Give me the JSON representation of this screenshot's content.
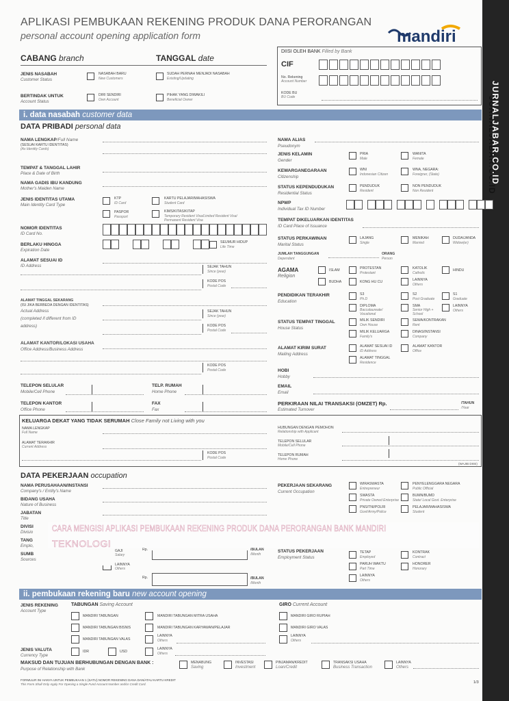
{
  "header": {
    "title": "APLIKASI PEMBUKAAN REKENING PRODUK DANA PERORANGAN",
    "subtitle": "personal account opening application form",
    "logo": "mandiri",
    "watermark": "JURNALJABAR.CO.ID"
  },
  "top": {
    "cabang": "CABANG",
    "cabang_en": "branch",
    "tanggal": "TANGGAL",
    "tanggal_en": "date",
    "jenis_nasabah": "JENIS NASABAH",
    "jenis_nasabah_en": "Customer Status",
    "nasabah_baru": "NASABAH BARU",
    "nasabah_baru_en": "New Customers",
    "sudah_pernah": "SUDAH PERNAH MENJADI NASABAH",
    "sudah_pernah_en": "Existing/Updating",
    "bertindak": "BERTINDAK UNTUK",
    "bertindak_en": "Account Status",
    "diri_sendiri": "DIRI SENDIRI",
    "diri_sendiri_en": "Own Account",
    "pihak_yang": "PIHAK YANG DIWAKILI",
    "pihak_yang_en": "Beneficial Owner",
    "diisi": "DIISI OLEH BANK",
    "diisi_en": "Filled by Bank",
    "cif": "CIF",
    "no_rek": "No. Rekening",
    "no_rek_en": "Account Number",
    "kode_bu": "KODE BU",
    "kode_bu_en": "BU Code"
  },
  "section1": {
    "num": "i. data nasabah",
    "en": "customer data"
  },
  "pribadi": {
    "title": "DATA PRIBADI",
    "title_en": "personal data",
    "nama_lengkap": "NAMA LENGKAP",
    "nama_lengkap_en": "/Full Name",
    "nama_note": "(SESUAI KARTU IDENTITAS)",
    "nama_note_en": "(As Identity Cards)",
    "ttl": "TEMPAT & TANGGAL LAHIR",
    "ttl_en": "Place & Date of Birth",
    "ibu": "NAMA GADIS IBU KANDUNG",
    "ibu_en": "Mother's Maiden Name",
    "identitas": "JENIS IDENTITAS UTAMA",
    "identitas_en": "Main Identity Card Type",
    "ktp": "KTP",
    "ktp_en": "ID Card",
    "paspor": "PASPOR",
    "paspor_en": "Passport",
    "kartu_pelajar": "KARTU PELAJAR/MAHASISWA",
    "kartu_pelajar_en": "Student Card",
    "kims": "KIMS/KITAS/KITAP",
    "kims_en1": "Temporary Resident Visa/Limited Resident Visa/",
    "kims_en2": "Permanent Resident Visa",
    "nomor": "NOMOR IDENTITAS",
    "nomor_en": "ID Card No.",
    "berlaku": "BERLAKU HINGGA",
    "berlaku_en": "Expiration Date",
    "seumur": "SEUMUR HIDUP",
    "seumur_en": "Life Time",
    "alamat_id": "ALAMAT SESUAI ID",
    "alamat_id_en": "ID Address",
    "sejak": "SEJAK TAHUN",
    "sejak_en": "Since (year)",
    "kodepos": "KODE POS",
    "kodepos_en": "Postal Code",
    "alamat_tinggal": "ALAMAT TINGGAL SEKARANG",
    "alamat_tinggal_note": "(ISI JIKA BERBEDA DENGAN IDENTITAS)",
    "alamat_tinggal_en": "Actual Address",
    "alamat_tinggal_en2": "(completed if different from ID",
    "alamat_tinggal_en3": "address)",
    "alamat_kantor": "ALAMAT KANTOR/LOKASI USAHA",
    "alamat_kantor_en": "Office Address/Business Address",
    "telp_seluler": "TELEPON SELULAR",
    "telp_seluler_en": "Mobile/Cell Phone",
    "telp_rumah": "TELP. RUMAH",
    "telp_rumah_en": "Home Phone",
    "telp_kantor": "TELEPON KANTOR",
    "telp_kantor_en": "Office Phone",
    "fax": "FAX",
    "fax_en": "Fax"
  },
  "right": {
    "alias": "NAMA ALIAS",
    "alias_en": "Pseudonym",
    "kelamin": "JENIS KELAMIN",
    "kelamin_en": "Gender",
    "pria": "PRIA",
    "pria_en": "Male",
    "wanita": "WANITA",
    "wanita_en": "Female",
    "kewarga": "KEWARGANEGARAAN",
    "kewarga_en": "Citizenship",
    "wni": "WNI",
    "wni_en": "Indonesian Citizen",
    "wna": "WNA, NEGARA:",
    "wna_en": "Foreigner, (State)",
    "status_kep": "STATUS KEPENDUDUKAN",
    "status_kep_en": "Residential Status",
    "penduduk": "PENDUDUK",
    "penduduk_en": "Resident",
    "non_penduduk": "NON PENDUDUK",
    "non_penduduk_en": "Non Resident",
    "npwp": "NPWP",
    "npwp_en": "Individual Tax ID Number",
    "tempat_keluar": "TEMPAT DIKELUARKAN IDENTITAS",
    "tempat_keluar_en": "ID Card Place of Issuance",
    "perkawinan": "STATUS PERKAWINAN",
    "perkawinan_en": "Marital Status",
    "lajang": "LAJANG",
    "lajang_en": "Single",
    "menikah": "MENIKAH",
    "menikah_en": "Married",
    "duda": "DUDA/JANDA",
    "duda_en": "Widow(er)",
    "tanggungan": "JUMLAH TANGGUNGAN",
    "tanggungan_en": "Dependant",
    "orang": "ORANG",
    "orang_en": "Person",
    "agama": "AGAMA",
    "agama_en": "Religion",
    "islam": "ISLAM",
    "protestan": "PROTESTAN",
    "protestan_en": "Protestant",
    "katolik": "KATOLIK",
    "katolik_en": "Catholic",
    "hindu": "HINDU",
    "budha": "BUDHA",
    "konghucu": "KONG HU CU",
    "lainnya": "LAINNYA",
    "lainnya_en": "Others",
    "pendidikan": "PENDIDIKAN TERAKHIR",
    "pendidikan_en": "Education",
    "s3": "S3",
    "s3_en": "Ph.D",
    "s2": "S2",
    "s2_en": "Post Graduate",
    "s1": "S1",
    "s1_en": "Graduate",
    "diploma": "DIPLOMA",
    "diploma_en": "Baccalaureate/",
    "diploma_en2": "Vocational",
    "sma": "SMA",
    "sma_en": "Senior High +",
    "sma_en2": "School",
    "status_tinggal": "STATUS TEMPAT TINGGAL",
    "status_tinggal_en": "House Status",
    "milik_sendiri": "MILIK SENDIRI",
    "milik_sendiri_en": "Own House",
    "sewa": "SEWA/KONTRAKAN",
    "sewa_en": "Rent",
    "milik_keluarga": "MILIK KELUARGA",
    "milik_keluarga_en": "Family's",
    "dinas": "DINAS/INSTANSI",
    "dinas_en": "Company",
    "kirim": "ALAMAT KIRIM SURAT",
    "kirim_en": "Mailing Address",
    "kirim_id": "ALAMAT SESUAI ID",
    "kirim_id_en": "ID Address",
    "kirim_kantor": "ALAMAT KANTOR",
    "kirim_kantor_en": "Office",
    "kirim_tinggal": "ALAMAT TINGGAL",
    "kirim_tinggal_en": "Residence",
    "hobi": "HOBI",
    "hobi_en": "Hobby",
    "email": "EMAIL",
    "email_en": "Email",
    "omzet": "PERKIRAAN NILAI TRANSAKSI (OMZET) Rp.",
    "omzet_en": "Estimated Turnover",
    "tahun": "/TAHUN",
    "tahun_en": "/Year"
  },
  "keluarga": {
    "title": "KELUARGA DEKAT YANG TIDAK SERUMAH",
    "title_en": "Close Family not Living with you",
    "nama": "NAMA LENGKAP",
    "nama_en": "Full Name",
    "alamat": "ALAMAT TERAKHIR",
    "alamat_en": "Current Address",
    "kodepos": "KODE POS",
    "kodepos_en": "Postal Code",
    "hubungan": "HUBUNGAN DENGAN PEMOHON",
    "hubungan_en": "Relationship with Applicant",
    "seluler": "TELEPON SELULAR",
    "seluler_en": "Mobile/Cell Phone",
    "rumah": "TELEPON RUMAH",
    "rumah_en": "Home Phone",
    "wajib": "(WAJIB DIISI)"
  },
  "pekerjaan": {
    "title": "DATA PEKERJAAN",
    "title_en": "occupation",
    "perusahaan": "NAMA PERUSAHAAN/INSTANSI",
    "perusahaan_en": "Company's / Entity's Name",
    "bidang": "BIDANG USAHA",
    "bidang_en": "Nature of Business",
    "jabatan": "JABATAN",
    "jabatan_en": "Title",
    "divisi": "DIVISI",
    "divisi_en": "Divisio",
    "tang": "TANG",
    "tang_en": "Emplo,",
    "sumb": "SUMB",
    "sumb_en": "Sources",
    "gaji": "GAJI",
    "gaji_en": "Salary",
    "lainnya": "LAINNYA",
    "lainnya_en": "Others",
    "rp": "Rp.",
    "bulan": "/BULAN",
    "bulan_en": "/Month",
    "sekarang": "PEKERJAAN SEKARANG",
    "sekarang_en": "Current Occupation",
    "wiraswasta": "WIRASWASTA",
    "wiraswasta_en": "Entrepreneur",
    "penyelenggara": "PENYELENGGARA NEGARA",
    "penyelenggara_en": "Public Official",
    "swasta": "SWASTA",
    "swasta_en": "Private Owned Enterprise",
    "bumn": "BUMN/BUMD",
    "bumn_en": "State/ Local Govt. Enterprise",
    "pns": "PNS/TNI/POLRI",
    "pns_en": "Govt/Army/Police",
    "pelajar": "PELAJAR/MAHASISWA",
    "pelajar_en": "Student",
    "status": "STATUS PEKERJAAN",
    "status_en": "Employment Status",
    "tetap": "TETAP",
    "tetap_en": "Employed",
    "kontrak": "KONTRAK",
    "kontrak_en": "Contract",
    "paruh": "PARUH WAKTU",
    "paruh_en": "Part Time",
    "honorer": "HONORER",
    "honorer_en": "Honorary",
    "lainnya2": "LAINNYA",
    "lainnya2_en": "Others"
  },
  "overlay": {
    "line1": "CARA MENGISI APLIKASI PEMBUKAAN REKENING PRODUK DANA PERORANGAN BANK MANDIRI",
    "line2": "TEKNOLOGI"
  },
  "section2": {
    "num": "ii. pembukaan rekening baru",
    "en": "new account opening"
  },
  "rekening": {
    "jenis": "JENIS REKENING",
    "jenis_en": "Account Type",
    "tabungan": "TABUNGAN",
    "tabungan_en": "Saving Account",
    "giro": "GIRO",
    "giro_en": "Current Account",
    "t1": "MANDIRI TABUNGAN",
    "t2": "MANDIRI TABUNGAN BISNIS",
    "t3": "MANDIRI TABUNGAN VALAS",
    "t4": "MANDIRI TABUNGAN MITRA USAHA",
    "t5": "MANDIRI TABUNGAN KARYAWAN/PELAJAR",
    "t6": "LAINNYA",
    "t6_en": "Others",
    "g1": "MANDIRI GIRO RUPIAH",
    "g2": "MANDIRI GIRO VALAS",
    "g3": "LAINNYA",
    "g3_en": "Others",
    "valuta": "JENIS VALUTA",
    "valuta_en": "Currency Type",
    "idr": "IDR",
    "usd": "USD",
    "lain": "LAINNYA",
    "lain_en": "Others",
    "maksud": "MAKSUD DAN TUJUAN BERHUBUNGAN DENGAN BANK :",
    "maksud_en": "Purpose of Relationship with Bank",
    "menabung": "MENABUNG",
    "menabung_en": "Saving",
    "investasi": "INVESTASI",
    "investasi_en": "Investment",
    "pinjaman": "PINJAMAN/KREDIT",
    "pinjaman_en": "Loan/Credit",
    "transaksi": "TRANSAKSI USAHA",
    "transaksi_en": "Business Transaction",
    "lainnya": "LAINNYA",
    "lainnya_en": "Others"
  },
  "footer": {
    "note1": "FORMULIR INI HANYA UNTUK PEMBUKAAN 1 (SATU) NOMOR REKENING DANA DAN/ATAU KARTU KREDIT",
    "note2": "This Form Shall Only Apply For Opening a Single Fund Account Number and/or Credit Card.",
    "page": "1/3"
  }
}
